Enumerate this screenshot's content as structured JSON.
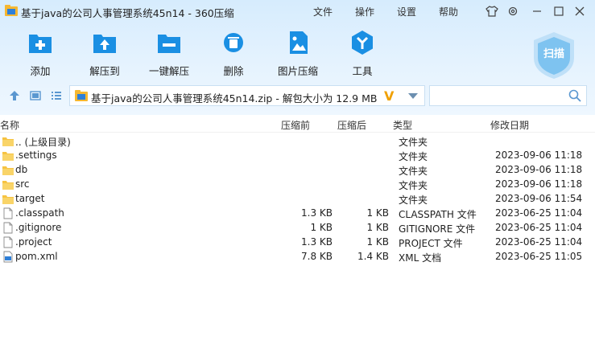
{
  "window": {
    "title": "基于java的公司人事管理系统45n14 - 360压缩",
    "menu": [
      "文件",
      "操作",
      "设置",
      "帮助"
    ]
  },
  "toolbar": {
    "items": [
      {
        "label": "添加",
        "icon": "add-icon"
      },
      {
        "label": "解压到",
        "icon": "extract-to-icon"
      },
      {
        "label": "一键解压",
        "icon": "one-click-extract-icon"
      },
      {
        "label": "删除",
        "icon": "delete-icon"
      },
      {
        "label": "图片压缩",
        "icon": "image-compress-icon"
      },
      {
        "label": "工具",
        "icon": "tools-icon"
      }
    ],
    "scan_label": "扫描"
  },
  "address": {
    "path": "基于java的公司人事管理系统45n14.zip - 解包大小为 12.9 MB"
  },
  "search": {
    "placeholder": ""
  },
  "columns": {
    "name": "名称",
    "before": "压缩前",
    "after": "压缩后",
    "type": "类型",
    "date": "修改日期"
  },
  "files": [
    {
      "name": ".. (上级目录)",
      "before": "",
      "after": "",
      "type": "文件夹",
      "date": "",
      "icon": "folder-icon"
    },
    {
      "name": ".settings",
      "before": "",
      "after": "",
      "type": "文件夹",
      "date": "2023-09-06 11:18",
      "icon": "folder-icon"
    },
    {
      "name": "db",
      "before": "",
      "after": "",
      "type": "文件夹",
      "date": "2023-09-06 11:18",
      "icon": "folder-icon"
    },
    {
      "name": "src",
      "before": "",
      "after": "",
      "type": "文件夹",
      "date": "2023-09-06 11:18",
      "icon": "folder-icon"
    },
    {
      "name": "target",
      "before": "",
      "after": "",
      "type": "文件夹",
      "date": "2023-09-06 11:54",
      "icon": "folder-icon"
    },
    {
      "name": ".classpath",
      "before": "1.3 KB",
      "after": "1 KB",
      "type": "CLASSPATH 文件",
      "date": "2023-06-25 11:04",
      "icon": "file-icon"
    },
    {
      "name": ".gitignore",
      "before": "1 KB",
      "after": "1 KB",
      "type": "GITIGNORE 文件",
      "date": "2023-06-25 11:04",
      "icon": "file-icon"
    },
    {
      "name": ".project",
      "before": "1.3 KB",
      "after": "1 KB",
      "type": "PROJECT 文件",
      "date": "2023-06-25 11:04",
      "icon": "file-icon"
    },
    {
      "name": "pom.xml",
      "before": "7.8 KB",
      "after": "1.4 KB",
      "type": "XML 文档",
      "date": "2023-06-25 11:05",
      "icon": "xml-file-icon"
    }
  ],
  "colors": {
    "accent": "#1a8fe3",
    "folder": "#f6c342",
    "band": "#e3f1fd"
  }
}
